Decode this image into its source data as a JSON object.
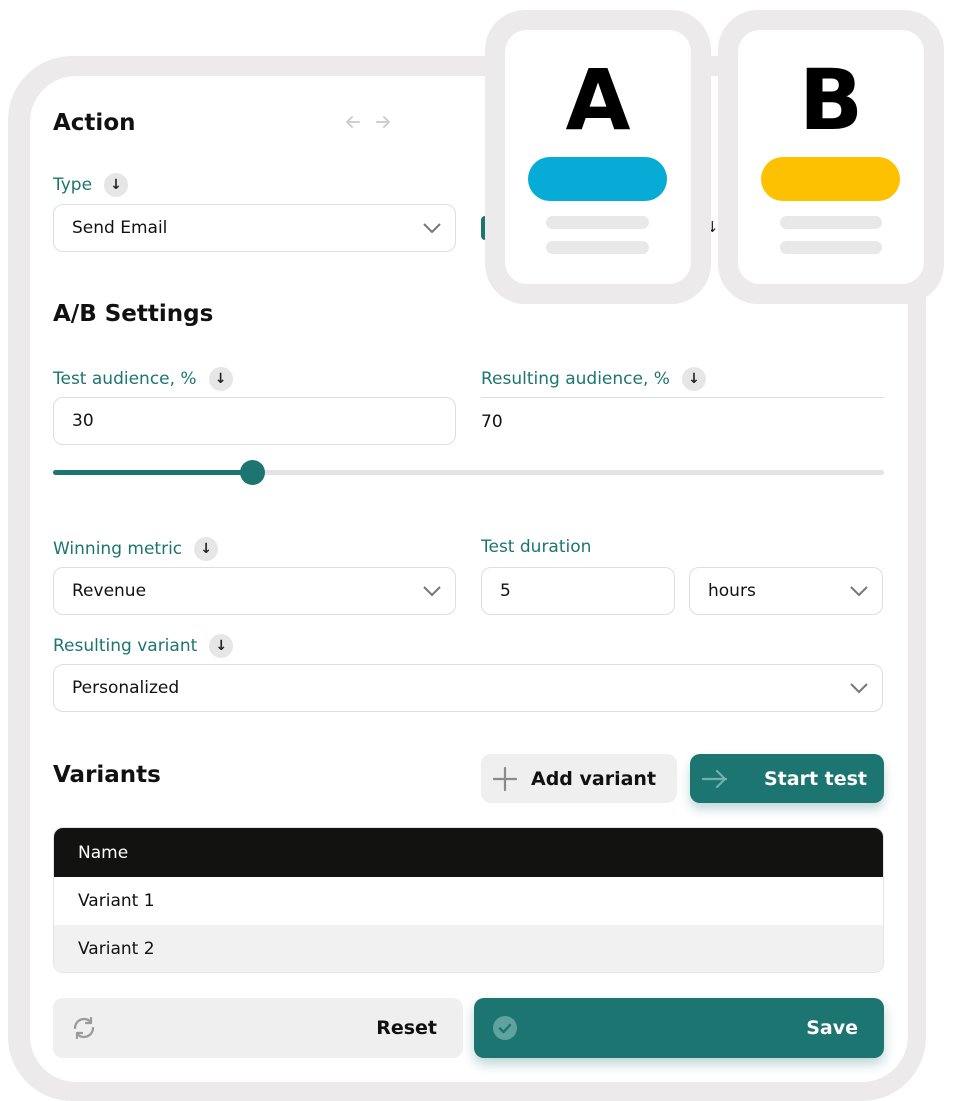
{
  "action": {
    "title": "Action",
    "type_label": "Type",
    "type_value": "Send Email"
  },
  "ab_settings": {
    "title": "A/B Settings",
    "test_audience_label": "Test audience, %",
    "test_audience_value": "30",
    "resulting_audience_label": "Resulting audience, %",
    "resulting_audience_value": "70",
    "slider_percent": 30,
    "winning_metric_label": "Winning metric",
    "winning_metric_value": "Revenue",
    "test_duration_label": "Test duration",
    "test_duration_value": "5",
    "test_duration_unit": "hours",
    "resulting_variant_label": "Resulting variant",
    "resulting_variant_value": "Personalized"
  },
  "variants": {
    "title": "Variants",
    "add_label": "Add variant",
    "start_label": "Start test",
    "column_name": "Name",
    "rows": [
      "Variant  1",
      "Variant 2"
    ]
  },
  "footer": {
    "reset_label": "Reset",
    "save_label": "Save"
  },
  "ab_cards": {
    "a_letter": "A",
    "b_letter": "B",
    "a_color": "#06abd6",
    "b_color": "#fec101"
  },
  "colors": {
    "accent": "#1d7571",
    "dark": "#121311"
  }
}
